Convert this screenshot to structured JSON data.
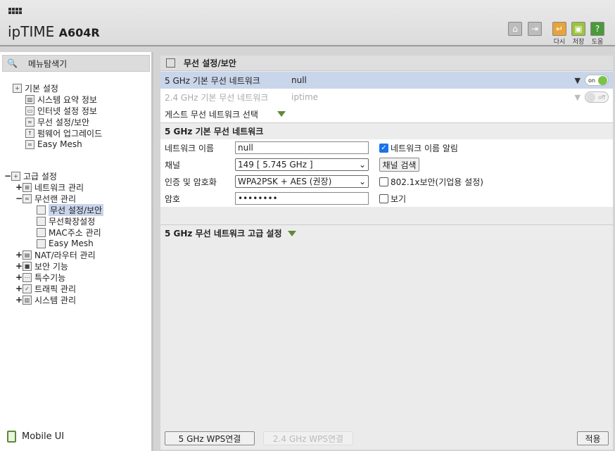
{
  "app": {
    "brand": "ipTIME",
    "model": "A604R"
  },
  "toolbar": {
    "home_label": "",
    "logout_label": "",
    "reload_label": "다시",
    "save_label": "저장",
    "help_label": "도움",
    "colors": {
      "reload": "#e8a33a",
      "save": "#9cc43e",
      "help": "#4a9a3a"
    }
  },
  "sidebar": {
    "title": "메뉴탐색기",
    "basic": {
      "label": "기본 설정",
      "items": [
        "시스템 요약 정보",
        "인터넷 설정 정보",
        "무선 설정/보안",
        "펌웨어 업그레이드",
        "Easy Mesh"
      ]
    },
    "advanced": {
      "label": "고급 설정",
      "groups": [
        {
          "label": "네트워크 관리",
          "expander": "+"
        },
        {
          "label": "무선랜 관리",
          "expander": "−",
          "items": [
            "무선 설정/보안",
            "무선확장설정",
            "MAC주소 관리",
            "Easy Mesh"
          ]
        },
        {
          "label": "NAT/라우터 관리",
          "expander": "+"
        },
        {
          "label": "보안 기능",
          "expander": "+"
        },
        {
          "label": "특수기능",
          "expander": "+"
        },
        {
          "label": "트래픽 관리",
          "expander": "+"
        },
        {
          "label": "시스템 관리",
          "expander": "+"
        }
      ]
    },
    "mobile_label": "Mobile UI"
  },
  "main": {
    "title": "무선 설정/보안",
    "networks": [
      {
        "band": "5 GHz 기본 무선 네트워크",
        "ssid": "null",
        "toggle": "on"
      },
      {
        "band": "2.4 GHz 기본 무선 네트워크",
        "ssid": "iptime",
        "toggle": "off"
      }
    ],
    "guest_label": "게스트 무선 네트워크 선택",
    "section_title": "5 GHz 기본 무선 네트워크",
    "form": {
      "name_label": "네트워크 이름",
      "name_value": "null",
      "broadcast_label": "네트워크 이름 알림",
      "channel_label": "채널",
      "channel_value": "149 [ 5.745 GHz ]",
      "channel_search": "채널 검색",
      "auth_label": "인증 및 암호화",
      "auth_value": "WPA2PSK + AES (권장)",
      "enterprise_label": "802.1x보안(기업용 설정)",
      "password_label": "암호",
      "password_value": "••••••••",
      "show_label": "보기"
    },
    "advanced_title": "5 GHz 무선 네트워크 고급 설정",
    "wps5": "5 GHz WPS연결",
    "wps24": "2.4 GHz WPS연결",
    "apply": "적용"
  }
}
